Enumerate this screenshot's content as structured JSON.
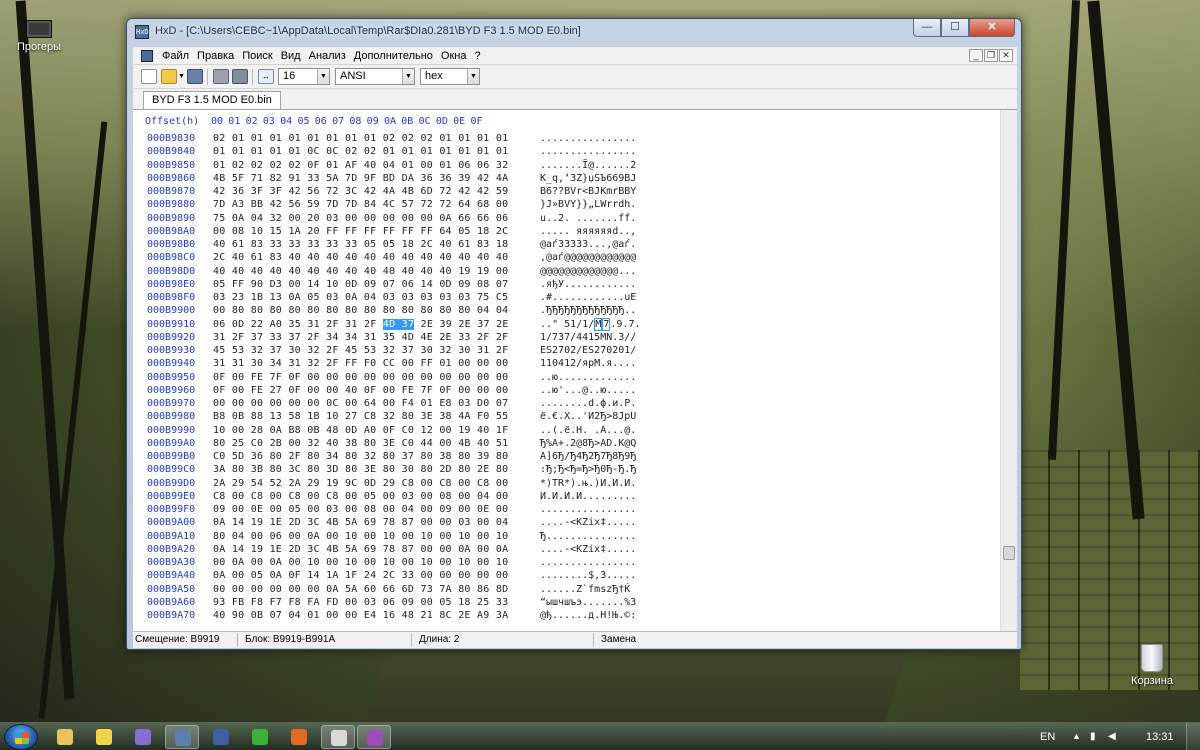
{
  "desktop": {
    "icons": [
      {
        "label": "Прогеры",
        "kind": "chip-icon"
      },
      {
        "label": "Корзина",
        "kind": "recycle-bin-icon"
      }
    ]
  },
  "window": {
    "title": "HxD - [C:\\Users\\CEBC~1\\AppData\\Local\\Temp\\Rar$DIa0.281\\BYD F3 1.5 MOD E0.bin]",
    "caption_buttons": {
      "minimize": "—",
      "maximize": "☐",
      "close": "✕"
    }
  },
  "menu": {
    "items": [
      "Файл",
      "Правка",
      "Поиск",
      "Вид",
      "Анализ",
      "Дополнительно",
      "Окна",
      "?"
    ],
    "mdi_buttons": [
      "_",
      "❐",
      "✕"
    ]
  },
  "toolbar": {
    "bytes_per_row": "16",
    "charset": "ANSI",
    "offset_base": "hex"
  },
  "tab": {
    "label": "BYD F3 1.5 MOD E0.bin"
  },
  "hex": {
    "header_offset": "Offset(h)",
    "header_cols": [
      "00",
      "01",
      "02",
      "03",
      "04",
      "05",
      "06",
      "07",
      "08",
      "09",
      "0A",
      "0B",
      "0C",
      "0D",
      "0E",
      "0F"
    ],
    "rows": [
      {
        "offset": "000B9830",
        "hex": "02 01 01 01 01 01 01 01 01 02 02 02 01 01 01 01",
        "ascii": "................"
      },
      {
        "offset": "000B9840",
        "hex": "01 01 01 01 01 0C 0C 02 02 01 01 01 01 01 01 01",
        "ascii": "................"
      },
      {
        "offset": "000B9850",
        "hex": "01 02 02 02 02 0F 01 AF 40 04 01 00 01 06 06 32",
        "ascii": ".......Ї@......2"
      },
      {
        "offset": "000B9860",
        "hex": "4B 5F 71 82 91 33 5A 7D 9F BD DA 36 36 39 42 4A",
        "ascii": "K_q‚‘3Z}џЅЪ669BJ"
      },
      {
        "offset": "000B9870",
        "hex": "42 36 3F 3F 42 56 72 3C 42 4A 4B 6D 72 42 42 59",
        "ascii": "B6??BVr<BJKmrBBY"
      },
      {
        "offset": "000B9880",
        "hex": "7D A3 BB 42 56 59 7D 7D 84 4C 57 72 72 64 68 00",
        "ascii": "}Ј»BVY}}„LWrrdh."
      },
      {
        "offset": "000B9890",
        "hex": "75 0A 04 32 00 20 03 00 00 00 00 00 0A 66 66 06",
        "ascii": "u..2. .......ff."
      },
      {
        "offset": "000B98A0",
        "hex": "00 08 10 15 1A 20 FF FF FF FF FF FF 64 05 18 2C",
        "ascii": "..... яяяяяяd..,"
      },
      {
        "offset": "000B98B0",
        "hex": "40 61 83 33 33 33 33 33 05 05 18 2C 40 61 83 18",
        "ascii": "@aѓ33333...,@aѓ."
      },
      {
        "offset": "000B98C0",
        "hex": "2C 40 61 83 40 40 40 40 40 40 40 40 40 40 40 40",
        "ascii": ",@aѓ@@@@@@@@@@@@"
      },
      {
        "offset": "000B98D0",
        "hex": "40 40 40 40 40 40 40 40 40 40 40 40 40 19 19 00",
        "ascii": "@@@@@@@@@@@@@..."
      },
      {
        "offset": "000B98E0",
        "hex": "05 FF 90 D3 00 14 10 0D 09 07 06 14 0D 09 08 07",
        "ascii": ".яђУ............"
      },
      {
        "offset": "000B98F0",
        "hex": "03 23 1B 13 0A 05 03 0A 04 03 03 03 03 03 75 C5",
        "ascii": ".#............uЕ"
      },
      {
        "offset": "000B9900",
        "hex": "00 80 80 80 80 80 80 80 80 80 80 80 80 80 04 04",
        "ascii": ".ЂЂЂЂЂЂЂЂЂЂЂЂЂ.."
      },
      {
        "offset": "000B9910",
        "hex": "06 0D 22 A0 35 31 2F 31 2F 4D 37 2E 39 2E 37 2E",
        "ascii": "..\" 51/1/M7.9.7.",
        "sel_start": 9,
        "sel_len": 2
      },
      {
        "offset": "000B9920",
        "hex": "31 2F 37 33 37 2F 34 34 31 35 4D 4E 2E 33 2F 2F",
        "ascii": "1/737/4415MN.3//"
      },
      {
        "offset": "000B9930",
        "hex": "45 53 32 37 30 32 2F 45 53 32 37 30 32 30 31 2F",
        "ascii": "ES2702/ES270201/"
      },
      {
        "offset": "000B9940",
        "hex": "31 31 30 34 31 32 2F FF F0 CC 00 FF 01 00 00 00",
        "ascii": "110412/яpМ.я...."
      },
      {
        "offset": "000B9950",
        "hex": "0F 00 FE 7F 0F 00 00 00 00 00 00 00 00 00 00 00",
        "ascii": "..ю............."
      },
      {
        "offset": "000B9960",
        "hex": "0F 00 FE 27 0F 00 00 40 0F 00 FE 7F 0F 00 00 00",
        "ascii": "..ю'...@..ю....."
      },
      {
        "offset": "000B9970",
        "hex": "00 00 00 00 00 00 0C 00 64 00 F4 01 E8 03 D0 07",
        "ascii": "........d.ф.и.Р."
      },
      {
        "offset": "000B9980",
        "hex": "B8 0B 88 13 58 1B 10 27 C8 32 80 3E 38 4A F0 55",
        "ascii": "ё.€.X..'И2Ђ>8JpU"
      },
      {
        "offset": "000B9990",
        "hex": "10 00 28 0A B8 0B 48 0D A0 0F C0 12 00 19 40 1F",
        "ascii": "..(.ё.H. .А...@."
      },
      {
        "offset": "000B99A0",
        "hex": "80 25 C0 2B 00 32 40 38 80 3E C0 44 00 4B 40 51",
        "ascii": "Ђ%А+.2@8Ђ>АD.K@Q"
      },
      {
        "offset": "000B99B0",
        "hex": "C0 5D 36 80 2F 80 34 80 32 80 37 80 38 80 39 80",
        "ascii": "А]6Ђ/Ђ4Ђ2Ђ7Ђ8Ђ9Ђ"
      },
      {
        "offset": "000B99C0",
        "hex": "3A 80 3B 80 3C 80 3D 80 3E 80 30 80 2D 80 2E 80",
        "ascii": ":Ђ;Ђ<Ђ=Ђ>Ђ0Ђ-Ђ.Ђ"
      },
      {
        "offset": "000B99D0",
        "hex": "2A 29 54 52 2A 29 19 9C 0D 29 C8 00 C8 00 C8 00",
        "ascii": "*)TR*).њ.)И.И.И."
      },
      {
        "offset": "000B99E0",
        "hex": "C8 00 C8 00 C8 00 C8 00 05 00 03 00 08 00 04 00",
        "ascii": "И.И.И.И........."
      },
      {
        "offset": "000B99F0",
        "hex": "09 00 0E 00 05 00 03 00 08 00 04 00 09 00 0E 00",
        "ascii": "................"
      },
      {
        "offset": "000B9A00",
        "hex": "0A 14 19 1E 2D 3C 4B 5A 69 78 87 00 00 03 00 04",
        "ascii": "....-<KZix‡....."
      },
      {
        "offset": "000B9A10",
        "hex": "80 04 00 06 00 0A 00 10 00 10 00 10 00 10 00 10",
        "ascii": "Ђ..............."
      },
      {
        "offset": "000B9A20",
        "hex": "0A 14 19 1E 2D 3C 4B 5A 69 78 87 00 00 0A 00 0A",
        "ascii": "....-<KZix‡....."
      },
      {
        "offset": "000B9A30",
        "hex": "00 0A 00 0A 00 10 00 10 00 10 00 10 00 10 00 10",
        "ascii": "................"
      },
      {
        "offset": "000B9A40",
        "hex": "0A 00 05 0A 0F 14 1A 1F 24 2C 33 00 00 00 00 00",
        "ascii": "........$,3....."
      },
      {
        "offset": "000B9A50",
        "hex": "00 00 00 00 00 00 0A 5A 60 66 6D 73 7A 80 86 8D",
        "ascii": "......Z`fmszЂ†Ќ"
      },
      {
        "offset": "000B9A60",
        "hex": "93 FB F8 F7 F8 FA FD 00 03 06 09 00 05 18 25 33",
        "ascii": "“ышчшъэ.......%3"
      },
      {
        "offset": "000B9A70",
        "hex": "40 90 0B 07 04 01 00 00 E4 16 48 21 8C 2E A9 3A",
        "ascii": "@ђ......д.H!Њ.©:"
      }
    ]
  },
  "status": {
    "offset": "Смещение: B9919",
    "block": "Блок: B9919-B991A",
    "length": "Длина: 2",
    "mode": "Замена"
  },
  "taskbar": {
    "lang": "EN",
    "time": "13:31",
    "apps": [
      "explorer-icon",
      "pen-icon",
      "media-player-icon",
      "hxd-icon",
      "floppy-icon",
      "utorrent-icon",
      "firefox-icon",
      "chrome-icon",
      "winrar-icon"
    ]
  }
}
